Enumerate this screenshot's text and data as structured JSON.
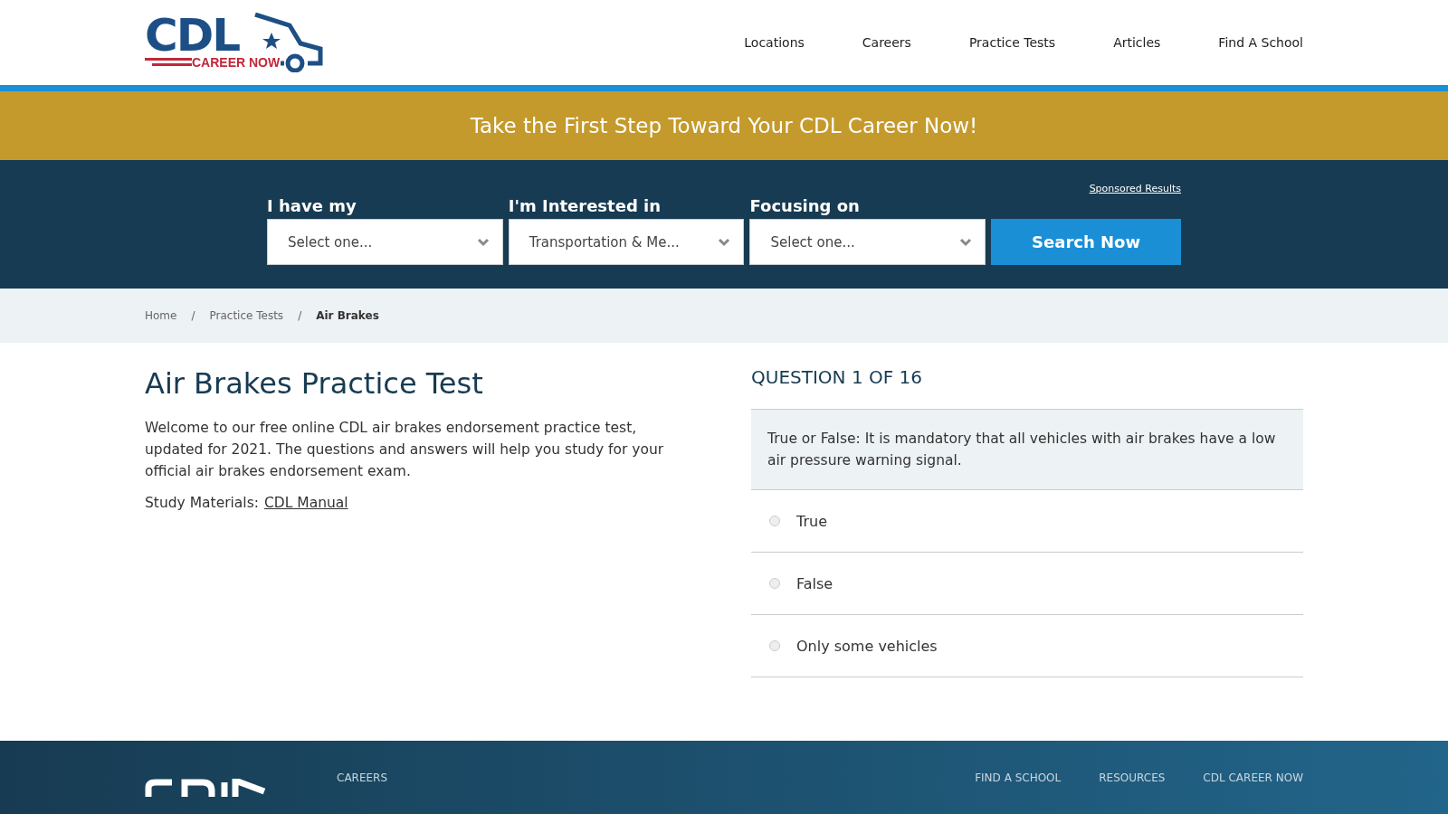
{
  "logo": {
    "title": "CDL",
    "subtitle": "CAREER NOW"
  },
  "nav": [
    "Locations",
    "Careers",
    "Practice Tests",
    "Articles",
    "Find A School"
  ],
  "banner": "Take the First Step Toward Your CDL Career Now!",
  "search": {
    "sponsored_link": "Sponsored Results",
    "button": "Search Now",
    "fields": [
      {
        "label": "I have my",
        "value": "Select one..."
      },
      {
        "label": "I'm Interested in",
        "value": "Transportation & Me..."
      },
      {
        "label": "Focusing on",
        "value": "Select one..."
      }
    ]
  },
  "breadcrumb": [
    {
      "label": "Home",
      "current": false
    },
    {
      "separator": "/",
      "label": "Practice Tests",
      "current": false
    },
    {
      "separator": "/",
      "label": "Air Brakes",
      "current": true
    }
  ],
  "intro": {
    "title": "Air Brakes Practice Test",
    "text": "Welcome to our free online CDL air brakes endorsement practice test, updated for 2021. The questions and answers will help you study for your official air brakes endorsement exam.",
    "study_label": "Study Materials:",
    "study_link": "CDL Manual"
  },
  "quiz": {
    "progress": "QUESTION 1 OF 16",
    "question": "True or False: It is mandatory that all vehicles with air brakes have a low air pressure warning signal.",
    "options": [
      {
        "label": "True",
        "selected": false
      },
      {
        "label": "False",
        "selected": false
      },
      {
        "label": "Only some vehicles",
        "selected": false
      }
    ]
  },
  "footer": {
    "columns": [
      "CAREERS",
      "FIND A SCHOOL",
      "RESOURCES",
      "CDL CAREER NOW"
    ]
  }
}
